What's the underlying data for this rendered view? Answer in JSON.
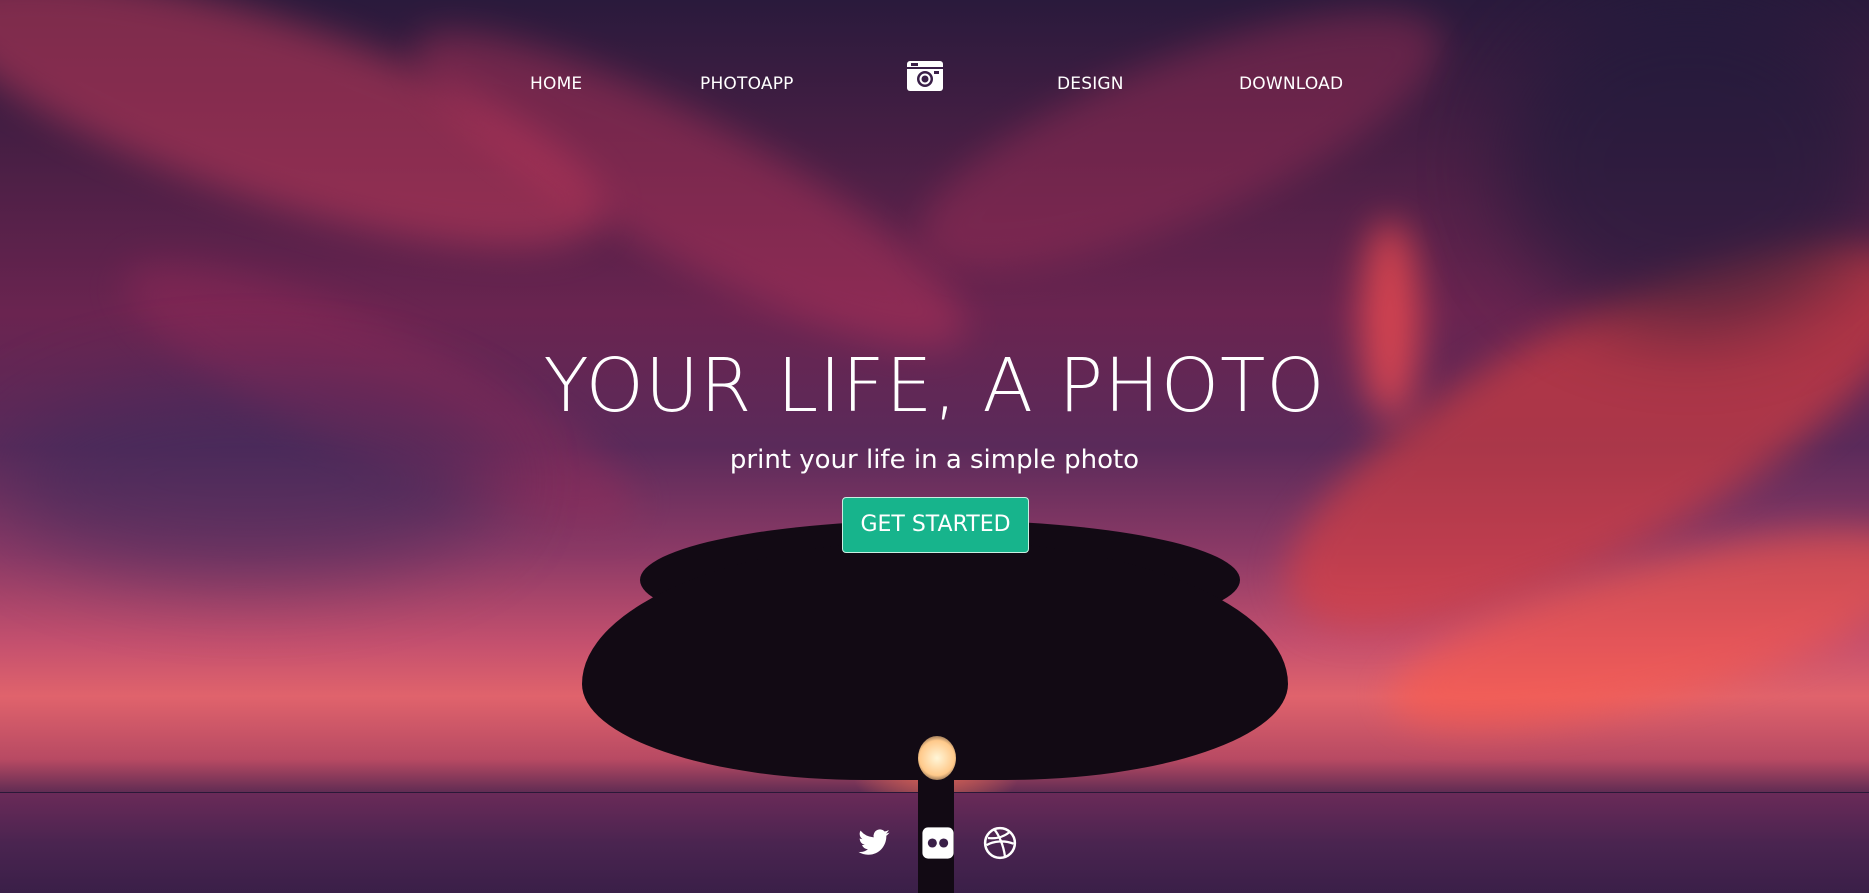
{
  "nav": {
    "items": [
      {
        "label": "HOME"
      },
      {
        "label": "PHOTOAPP"
      },
      {
        "label": "DESIGN"
      },
      {
        "label": "DOWNLOAD"
      }
    ],
    "logo_icon": "camera-icon"
  },
  "hero": {
    "title": "YOUR LIFE, A PHOTO",
    "subtitle": "print your life in a simple photo",
    "cta_label": "GET STARTED"
  },
  "social": [
    {
      "icon": "twitter-icon"
    },
    {
      "icon": "flickr-icon"
    },
    {
      "icon": "dribbble-icon"
    }
  ],
  "colors": {
    "accent": "#17b48c",
    "text": "#ffffff"
  }
}
